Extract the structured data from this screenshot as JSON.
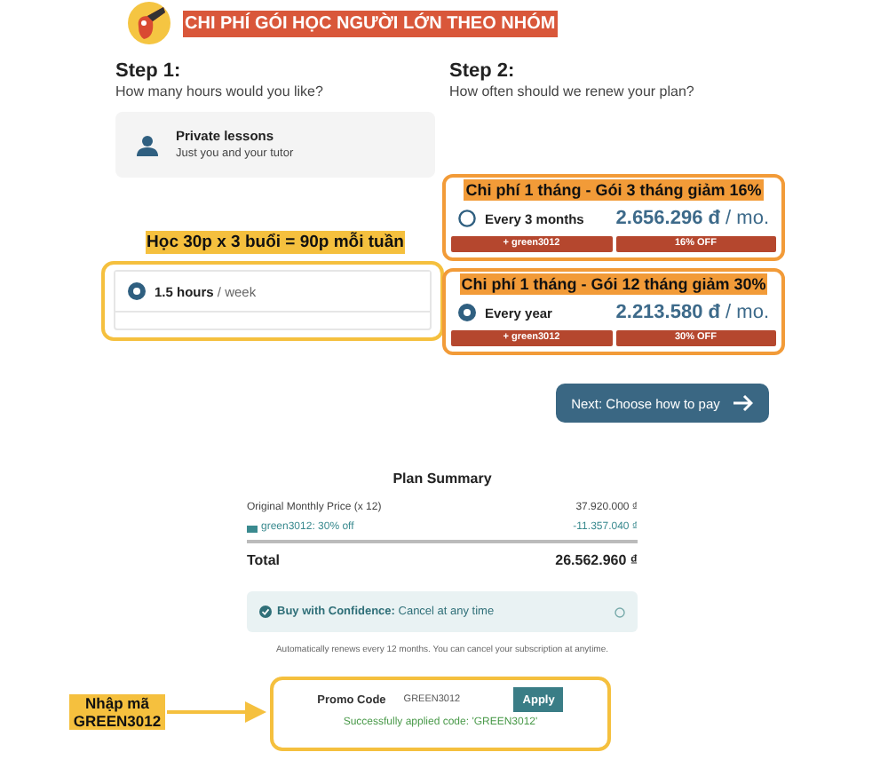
{
  "header": {
    "title": "CHI PHÍ GÓI HỌC NGƯỜI LỚN THEO NHÓM"
  },
  "step1": {
    "heading": "Step 1:",
    "question": "How many hours would you like?",
    "lesson_type": {
      "title": "Private lessons",
      "subtitle": "Just you and your tutor"
    },
    "annotation": "Học 30p x 3 buổi = 90p mỗi tuần",
    "hours_options": [
      {
        "hours": "1.5 hours",
        "unit": "/ week",
        "selected": true
      }
    ]
  },
  "step2": {
    "heading": "Step 2:",
    "question": "How often should we renew your plan?",
    "plans": [
      {
        "annotation": "Chi phí 1 tháng - Gói 3 tháng giảm 16%",
        "label": "Every 3 months",
        "price": "2.656.296 đ",
        "unit": "/ mo.",
        "promo": "+ green3012",
        "discount": "16% OFF",
        "selected": false
      },
      {
        "annotation": "Chi phí 1 tháng - Gói 12 tháng giảm 30%",
        "label": "Every year",
        "price": "2.213.580 đ",
        "unit": "/ mo.",
        "promo": "+ green3012",
        "discount": "30% OFF",
        "selected": true
      }
    ]
  },
  "next_button": "Next: Choose how to pay",
  "summary": {
    "title": "Plan Summary",
    "rows": [
      {
        "kind": "price",
        "label": "Original Monthly Price (x 12)",
        "value": "37.920.000 ₫"
      },
      {
        "kind": "discount",
        "label": "green3012: 30% off",
        "value": "-11.357.040 ₫"
      },
      {
        "kind": "total",
        "label": "Total",
        "value": "26.562.960 ₫"
      }
    ]
  },
  "confidence": {
    "label": "Buy with Confidence:",
    "text": "Cancel at any time"
  },
  "renew_note": "Automatically renews every 12 months. You can cancel your subscription at anytime.",
  "promo": {
    "label": "Promo Code",
    "value": "GREEN3012",
    "button": "Apply",
    "message": "Successfully applied code: 'GREEN3012'",
    "annotation": "Nhập mã GREEN3012"
  }
}
